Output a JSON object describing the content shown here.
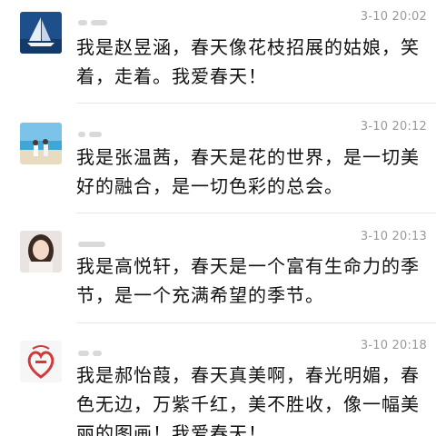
{
  "messages": [
    {
      "avatar": "sailboat-photo-avatar",
      "time": "3-10 20:02",
      "text": "我是赵昱涵，春天像花枝招展的姑娘，笑着，走着。我爱春天！"
    },
    {
      "avatar": "beach-people-photo-avatar",
      "time": "3-10 20:12",
      "text": "我是张温茜，春天是花的世界，是一切美好的融合，是一切色彩的总会。"
    },
    {
      "avatar": "woman-portrait-avatar",
      "time": "3-10 20:13",
      "text": "我是高悦轩，春天是一个富有生命力的季节，是一个充满希望的季节。"
    },
    {
      "avatar": "ping-an-emblem-avatar",
      "time": "3-10 20:18",
      "text": "我是郝怡葭，春天真美啊，春光明媚，春色无边，万紫千红，美不胜收，像一幅美丽的图画！我爱春天！"
    }
  ],
  "colors": {
    "text": "#111111",
    "time": "#9a9a9a",
    "divider": "#e6e6e6",
    "emblem_red": "#d23a3a"
  }
}
